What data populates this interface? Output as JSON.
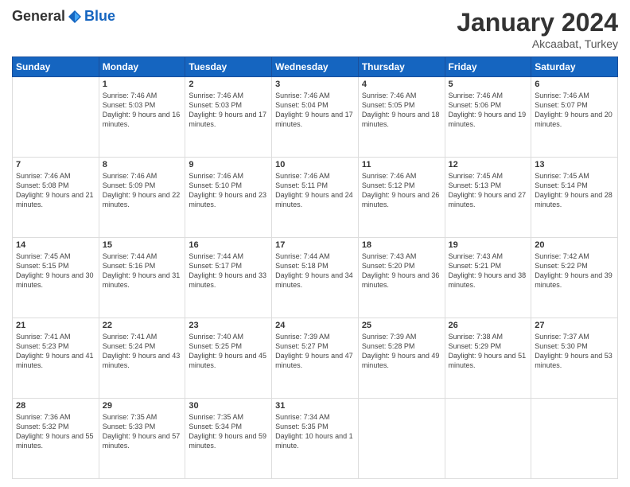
{
  "header": {
    "logo_general": "General",
    "logo_blue": "Blue",
    "month_title": "January 2024",
    "location": "Akcaabat, Turkey"
  },
  "weekdays": [
    "Sunday",
    "Monday",
    "Tuesday",
    "Wednesday",
    "Thursday",
    "Friday",
    "Saturday"
  ],
  "weeks": [
    [
      {
        "day": "",
        "sunrise": "",
        "sunset": "",
        "daylight": ""
      },
      {
        "day": "1",
        "sunrise": "Sunrise: 7:46 AM",
        "sunset": "Sunset: 5:03 PM",
        "daylight": "Daylight: 9 hours and 16 minutes."
      },
      {
        "day": "2",
        "sunrise": "Sunrise: 7:46 AM",
        "sunset": "Sunset: 5:03 PM",
        "daylight": "Daylight: 9 hours and 17 minutes."
      },
      {
        "day": "3",
        "sunrise": "Sunrise: 7:46 AM",
        "sunset": "Sunset: 5:04 PM",
        "daylight": "Daylight: 9 hours and 17 minutes."
      },
      {
        "day": "4",
        "sunrise": "Sunrise: 7:46 AM",
        "sunset": "Sunset: 5:05 PM",
        "daylight": "Daylight: 9 hours and 18 minutes."
      },
      {
        "day": "5",
        "sunrise": "Sunrise: 7:46 AM",
        "sunset": "Sunset: 5:06 PM",
        "daylight": "Daylight: 9 hours and 19 minutes."
      },
      {
        "day": "6",
        "sunrise": "Sunrise: 7:46 AM",
        "sunset": "Sunset: 5:07 PM",
        "daylight": "Daylight: 9 hours and 20 minutes."
      }
    ],
    [
      {
        "day": "7",
        "sunrise": "Sunrise: 7:46 AM",
        "sunset": "Sunset: 5:08 PM",
        "daylight": "Daylight: 9 hours and 21 minutes."
      },
      {
        "day": "8",
        "sunrise": "Sunrise: 7:46 AM",
        "sunset": "Sunset: 5:09 PM",
        "daylight": "Daylight: 9 hours and 22 minutes."
      },
      {
        "day": "9",
        "sunrise": "Sunrise: 7:46 AM",
        "sunset": "Sunset: 5:10 PM",
        "daylight": "Daylight: 9 hours and 23 minutes."
      },
      {
        "day": "10",
        "sunrise": "Sunrise: 7:46 AM",
        "sunset": "Sunset: 5:11 PM",
        "daylight": "Daylight: 9 hours and 24 minutes."
      },
      {
        "day": "11",
        "sunrise": "Sunrise: 7:46 AM",
        "sunset": "Sunset: 5:12 PM",
        "daylight": "Daylight: 9 hours and 26 minutes."
      },
      {
        "day": "12",
        "sunrise": "Sunrise: 7:45 AM",
        "sunset": "Sunset: 5:13 PM",
        "daylight": "Daylight: 9 hours and 27 minutes."
      },
      {
        "day": "13",
        "sunrise": "Sunrise: 7:45 AM",
        "sunset": "Sunset: 5:14 PM",
        "daylight": "Daylight: 9 hours and 28 minutes."
      }
    ],
    [
      {
        "day": "14",
        "sunrise": "Sunrise: 7:45 AM",
        "sunset": "Sunset: 5:15 PM",
        "daylight": "Daylight: 9 hours and 30 minutes."
      },
      {
        "day": "15",
        "sunrise": "Sunrise: 7:44 AM",
        "sunset": "Sunset: 5:16 PM",
        "daylight": "Daylight: 9 hours and 31 minutes."
      },
      {
        "day": "16",
        "sunrise": "Sunrise: 7:44 AM",
        "sunset": "Sunset: 5:17 PM",
        "daylight": "Daylight: 9 hours and 33 minutes."
      },
      {
        "day": "17",
        "sunrise": "Sunrise: 7:44 AM",
        "sunset": "Sunset: 5:18 PM",
        "daylight": "Daylight: 9 hours and 34 minutes."
      },
      {
        "day": "18",
        "sunrise": "Sunrise: 7:43 AM",
        "sunset": "Sunset: 5:20 PM",
        "daylight": "Daylight: 9 hours and 36 minutes."
      },
      {
        "day": "19",
        "sunrise": "Sunrise: 7:43 AM",
        "sunset": "Sunset: 5:21 PM",
        "daylight": "Daylight: 9 hours and 38 minutes."
      },
      {
        "day": "20",
        "sunrise": "Sunrise: 7:42 AM",
        "sunset": "Sunset: 5:22 PM",
        "daylight": "Daylight: 9 hours and 39 minutes."
      }
    ],
    [
      {
        "day": "21",
        "sunrise": "Sunrise: 7:41 AM",
        "sunset": "Sunset: 5:23 PM",
        "daylight": "Daylight: 9 hours and 41 minutes."
      },
      {
        "day": "22",
        "sunrise": "Sunrise: 7:41 AM",
        "sunset": "Sunset: 5:24 PM",
        "daylight": "Daylight: 9 hours and 43 minutes."
      },
      {
        "day": "23",
        "sunrise": "Sunrise: 7:40 AM",
        "sunset": "Sunset: 5:25 PM",
        "daylight": "Daylight: 9 hours and 45 minutes."
      },
      {
        "day": "24",
        "sunrise": "Sunrise: 7:39 AM",
        "sunset": "Sunset: 5:27 PM",
        "daylight": "Daylight: 9 hours and 47 minutes."
      },
      {
        "day": "25",
        "sunrise": "Sunrise: 7:39 AM",
        "sunset": "Sunset: 5:28 PM",
        "daylight": "Daylight: 9 hours and 49 minutes."
      },
      {
        "day": "26",
        "sunrise": "Sunrise: 7:38 AM",
        "sunset": "Sunset: 5:29 PM",
        "daylight": "Daylight: 9 hours and 51 minutes."
      },
      {
        "day": "27",
        "sunrise": "Sunrise: 7:37 AM",
        "sunset": "Sunset: 5:30 PM",
        "daylight": "Daylight: 9 hours and 53 minutes."
      }
    ],
    [
      {
        "day": "28",
        "sunrise": "Sunrise: 7:36 AM",
        "sunset": "Sunset: 5:32 PM",
        "daylight": "Daylight: 9 hours and 55 minutes."
      },
      {
        "day": "29",
        "sunrise": "Sunrise: 7:35 AM",
        "sunset": "Sunset: 5:33 PM",
        "daylight": "Daylight: 9 hours and 57 minutes."
      },
      {
        "day": "30",
        "sunrise": "Sunrise: 7:35 AM",
        "sunset": "Sunset: 5:34 PM",
        "daylight": "Daylight: 9 hours and 59 minutes."
      },
      {
        "day": "31",
        "sunrise": "Sunrise: 7:34 AM",
        "sunset": "Sunset: 5:35 PM",
        "daylight": "Daylight: 10 hours and 1 minute."
      },
      {
        "day": "",
        "sunrise": "",
        "sunset": "",
        "daylight": ""
      },
      {
        "day": "",
        "sunrise": "",
        "sunset": "",
        "daylight": ""
      },
      {
        "day": "",
        "sunrise": "",
        "sunset": "",
        "daylight": ""
      }
    ]
  ]
}
